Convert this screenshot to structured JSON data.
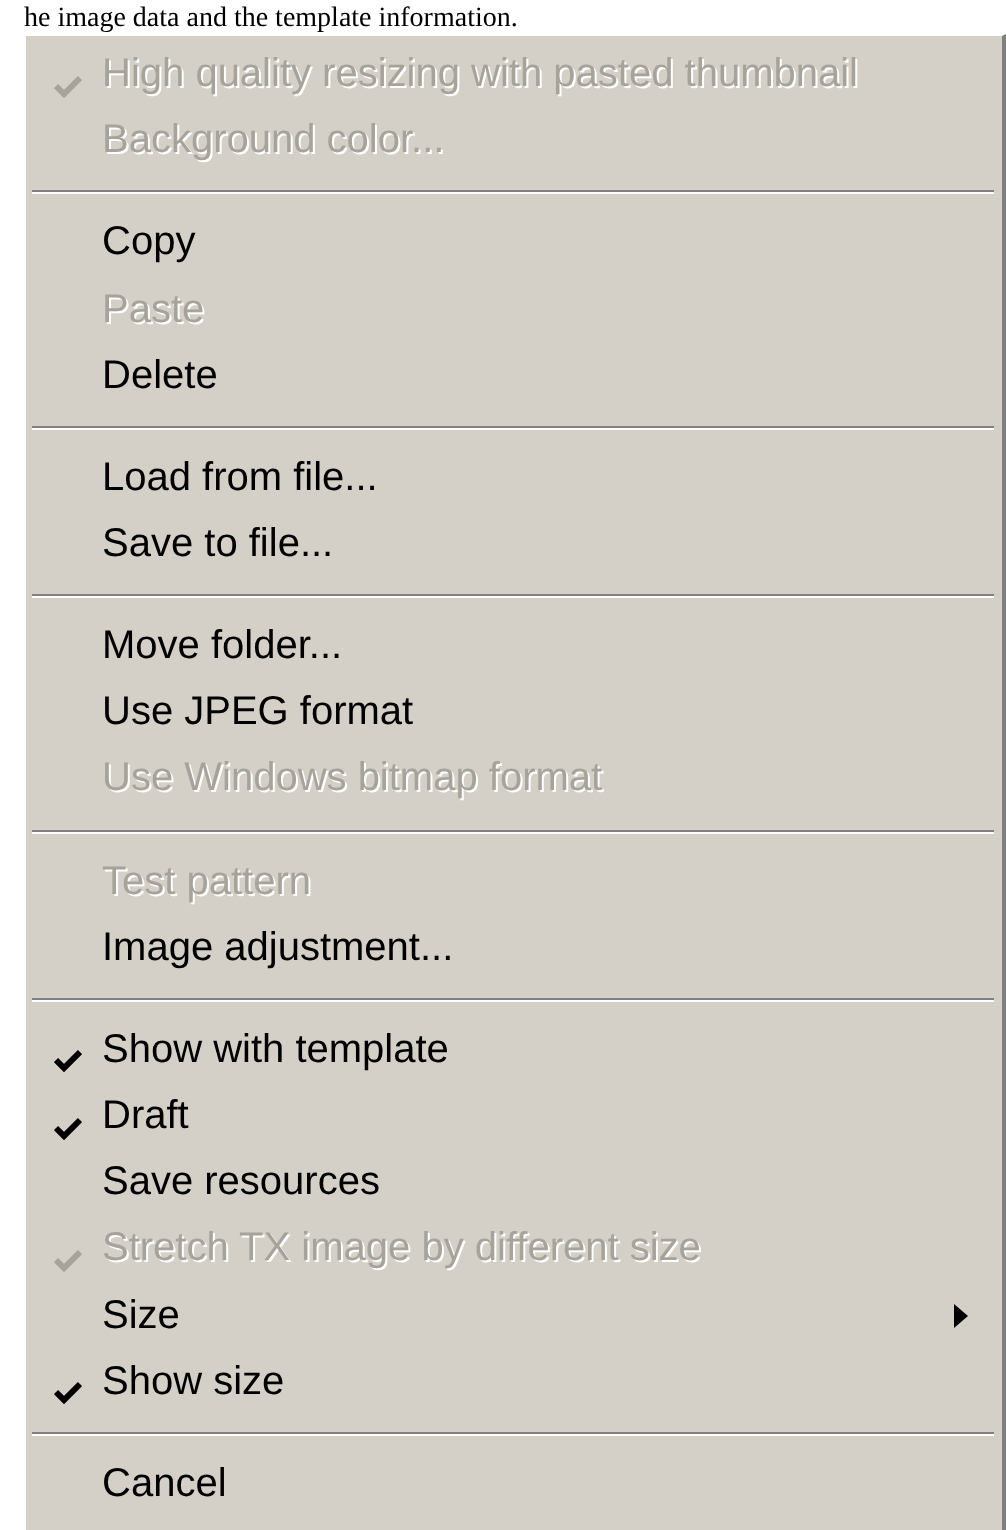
{
  "caption": "he image data and the template information.",
  "menu": {
    "groups": [
      {
        "items": [
          {
            "label": "High quality resizing with pasted thumbnail",
            "checked": true,
            "disabled": true,
            "submenu": false
          },
          {
            "label": "Background color...",
            "checked": false,
            "disabled": true,
            "submenu": false
          }
        ]
      },
      {
        "items": [
          {
            "label": "Copy",
            "checked": false,
            "disabled": false,
            "submenu": false
          },
          {
            "label": "Paste",
            "checked": false,
            "disabled": true,
            "submenu": false
          },
          {
            "label": "Delete",
            "checked": false,
            "disabled": false,
            "submenu": false
          }
        ]
      },
      {
        "items": [
          {
            "label": "Load from file...",
            "checked": false,
            "disabled": false,
            "submenu": false
          },
          {
            "label": "Save to file...",
            "checked": false,
            "disabled": false,
            "submenu": false
          }
        ]
      },
      {
        "items": [
          {
            "label": "Move folder...",
            "checked": false,
            "disabled": false,
            "submenu": false
          },
          {
            "label": "Use JPEG format",
            "checked": false,
            "disabled": false,
            "submenu": false
          },
          {
            "label": "Use Windows bitmap format",
            "checked": false,
            "disabled": true,
            "submenu": false
          }
        ]
      },
      {
        "items": [
          {
            "label": "Test pattern",
            "checked": false,
            "disabled": true,
            "submenu": false
          },
          {
            "label": "Image adjustment...",
            "checked": false,
            "disabled": false,
            "submenu": false
          }
        ]
      },
      {
        "items": [
          {
            "label": "Show with template",
            "checked": true,
            "disabled": false,
            "submenu": false
          },
          {
            "label": "Draft",
            "checked": true,
            "disabled": false,
            "submenu": false
          },
          {
            "label": "Save resources",
            "checked": false,
            "disabled": false,
            "submenu": false
          },
          {
            "label": "Stretch TX image by different size",
            "checked": true,
            "disabled": true,
            "submenu": false
          },
          {
            "label": "Size",
            "checked": false,
            "disabled": false,
            "submenu": true
          },
          {
            "label": "Show size",
            "checked": true,
            "disabled": false,
            "submenu": false
          }
        ]
      },
      {
        "items": [
          {
            "label": "Cancel",
            "checked": false,
            "disabled": false,
            "submenu": false
          }
        ]
      }
    ]
  }
}
